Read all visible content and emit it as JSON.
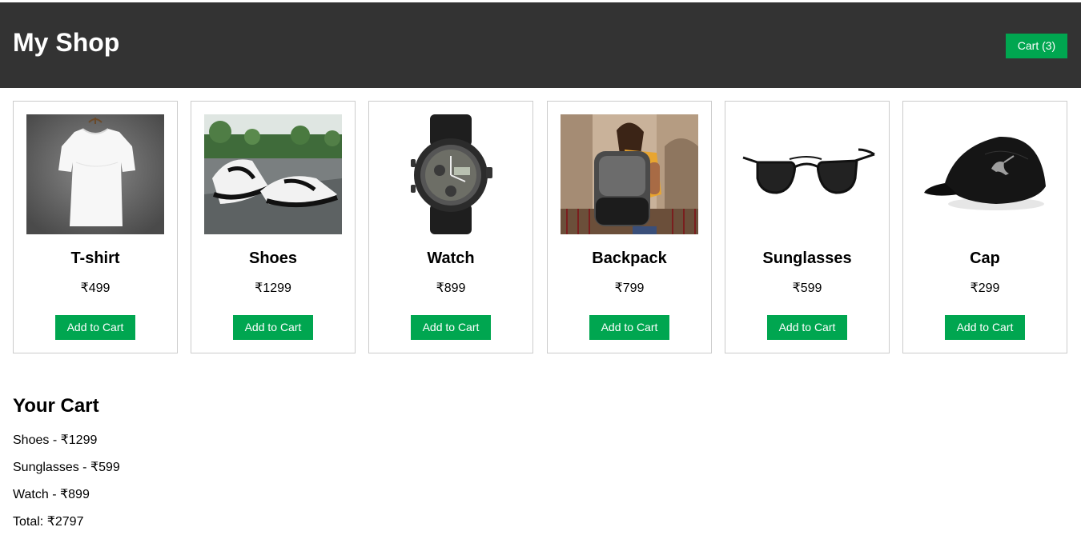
{
  "header": {
    "title": "My Shop",
    "cart_button": "Cart (3)"
  },
  "products": [
    {
      "name": "T-shirt",
      "price": "₹499",
      "button": "Add to Cart",
      "image": "tshirt"
    },
    {
      "name": "Shoes",
      "price": "₹1299",
      "button": "Add to Cart",
      "image": "shoes"
    },
    {
      "name": "Watch",
      "price": "₹899",
      "button": "Add to Cart",
      "image": "watch"
    },
    {
      "name": "Backpack",
      "price": "₹799",
      "button": "Add to Cart",
      "image": "backpack"
    },
    {
      "name": "Sunglasses",
      "price": "₹599",
      "button": "Add to Cart",
      "image": "sunglasses"
    },
    {
      "name": "Cap",
      "price": "₹299",
      "button": "Add to Cart",
      "image": "cap"
    }
  ],
  "cart": {
    "heading": "Your Cart",
    "items": [
      "Shoes - ₹1299",
      "Sunglasses - ₹599",
      "Watch - ₹899"
    ],
    "total": "Total: ₹2797"
  },
  "colors": {
    "header_bg": "#333333",
    "accent": "#00a650",
    "card_border": "#cccccc"
  }
}
